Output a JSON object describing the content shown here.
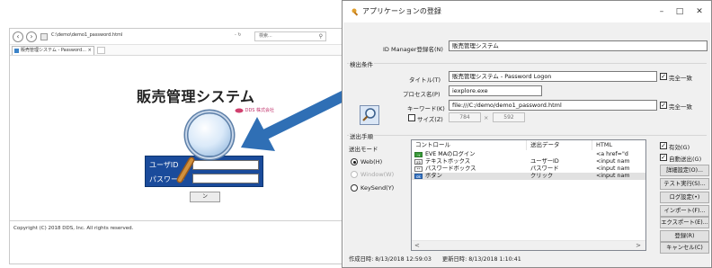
{
  "browser": {
    "url": "C:\\demo\\demo1_password.html",
    "url_controls": "- ↻",
    "search_placeholder": "検索...",
    "tab_title": "販売管理システム - Password...",
    "tab_close": "×",
    "page_title": "販売管理システム",
    "logo_text": "DDS 株式会社",
    "user_id_label": "ユーザID",
    "password_label": "パスワード",
    "login_button": "ン",
    "footer": "Copyright (C) 2018 DDS, Inc. All rights reserved."
  },
  "dialog": {
    "title": "アプリケーションの登録",
    "window_controls": {
      "minimize": "–",
      "maximize": "□",
      "close": "✕"
    },
    "name_label": "ID Manager登録名(N)",
    "name_value": "販売管理システム",
    "detection": {
      "group_title": "検出条件",
      "title_label": "タイトル(T)",
      "title_value": "販売管理システム - Password Logon",
      "process_label": "プロセス名(P)",
      "process_value": "iexplore.exe",
      "key_label": "キーワード(K)",
      "key_value": "file:///C:/demo/demo1_password.html",
      "exact_match": "完全一致",
      "size_label": "サイズ(Z)",
      "size_width": "784",
      "size_sep": "×",
      "size_height": "592"
    },
    "procedure": {
      "group_title": "送出手順",
      "mode_label": "送出モード",
      "modes": [
        "Web(H)",
        "Window(W)",
        "KeySend(Y)"
      ],
      "columns": [
        "コントロール",
        "送出データ",
        "HTML"
      ],
      "rows": [
        {
          "icon": "→",
          "control": "EVE MAのログイン",
          "data": "",
          "html": "<a href=\"d"
        },
        {
          "icon": "ab",
          "control": "テキストボックス",
          "data": "ユーザーID",
          "html": "<input nam"
        },
        {
          "icon": "**",
          "control": "パスワードボックス",
          "data": "パスワード",
          "html": "<input nam"
        },
        {
          "icon": "ok",
          "control": "ボタン",
          "data": "クリック",
          "html": "<input nam"
        }
      ],
      "scroll_left": "<",
      "scroll_right": ">"
    },
    "right_panel": {
      "enabled": "有効(G)",
      "auto_send": "自動送出(G)",
      "buttons": [
        "詳細設定(O)...",
        "テスト実行(S)...",
        "ログ設定(•)",
        "インポート(F)...",
        "エクスポート(E)...",
        "登録(R)",
        "キャンセル(C)"
      ]
    },
    "status": {
      "created": "作成日時: 8/13/2018 12:59:03",
      "updated": "更新日時: 8/13/2018 1:10:41"
    }
  },
  "colors": {
    "login_panel": "#1a4b9b",
    "arrow": "#2f6fb5",
    "link_accent": "#c0306a"
  }
}
